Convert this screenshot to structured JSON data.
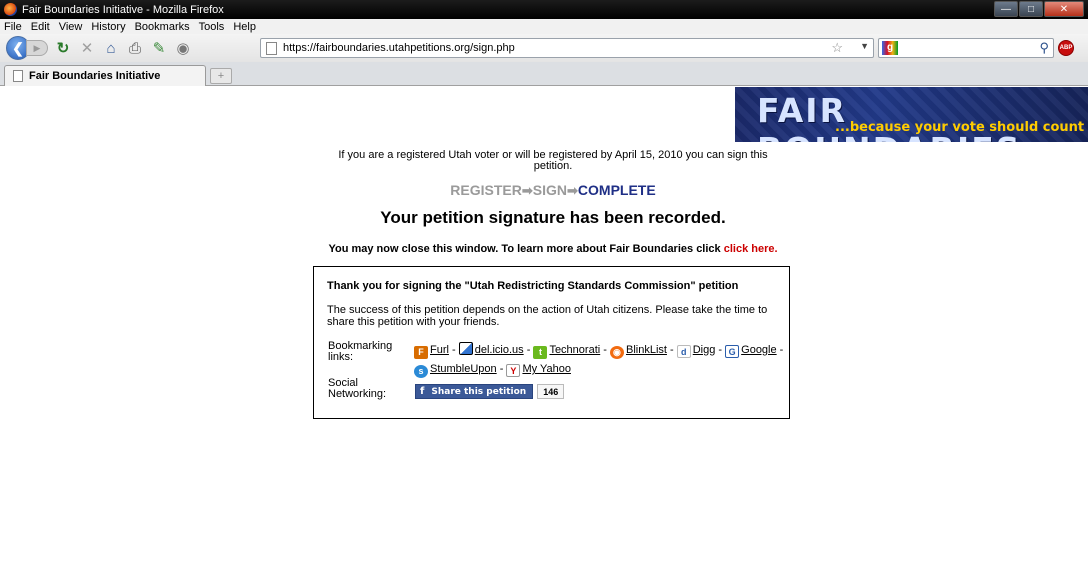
{
  "window": {
    "title": "Fair Boundaries Initiative - Mozilla Firefox"
  },
  "menu": {
    "items": [
      "File",
      "Edit",
      "View",
      "History",
      "Bookmarks",
      "Tools",
      "Help"
    ]
  },
  "navbar": {
    "url": "https://fairboundaries.utahpetitions.org/sign.php"
  },
  "tab": {
    "label": "Fair Boundaries Initiative"
  },
  "banner": {
    "title": "FAIR BOUNDARIES",
    "tagline": "...because your vote should count"
  },
  "page": {
    "intro": "If you are a registered Utah voter or will be registered by April 15, 2010 you can sign this petition.",
    "steps": {
      "register": "REGISTER",
      "sign": "SIGN",
      "complete": "COMPLETE"
    },
    "headline": "Your petition signature has been recorded.",
    "close_text": "You may now close this window. To learn more about Fair Boundaries click",
    "close_link": "click here."
  },
  "share_box": {
    "title": "Thank you for signing the \"Utah Redistricting Standards Commission\" petition",
    "description": "The success of this petition depends on the action of Utah citizens. Please take the time to share this petition with your friends.",
    "bookmarking_label": "Bookmarking links:",
    "links": [
      "Furl",
      "del.icio.us",
      "Technorati",
      "BlinkList",
      "Digg",
      "Google",
      "StumbleUpon",
      "My Yahoo"
    ],
    "social_label": "Social Networking:",
    "share_button": "Share this petition",
    "share_count": "146"
  }
}
